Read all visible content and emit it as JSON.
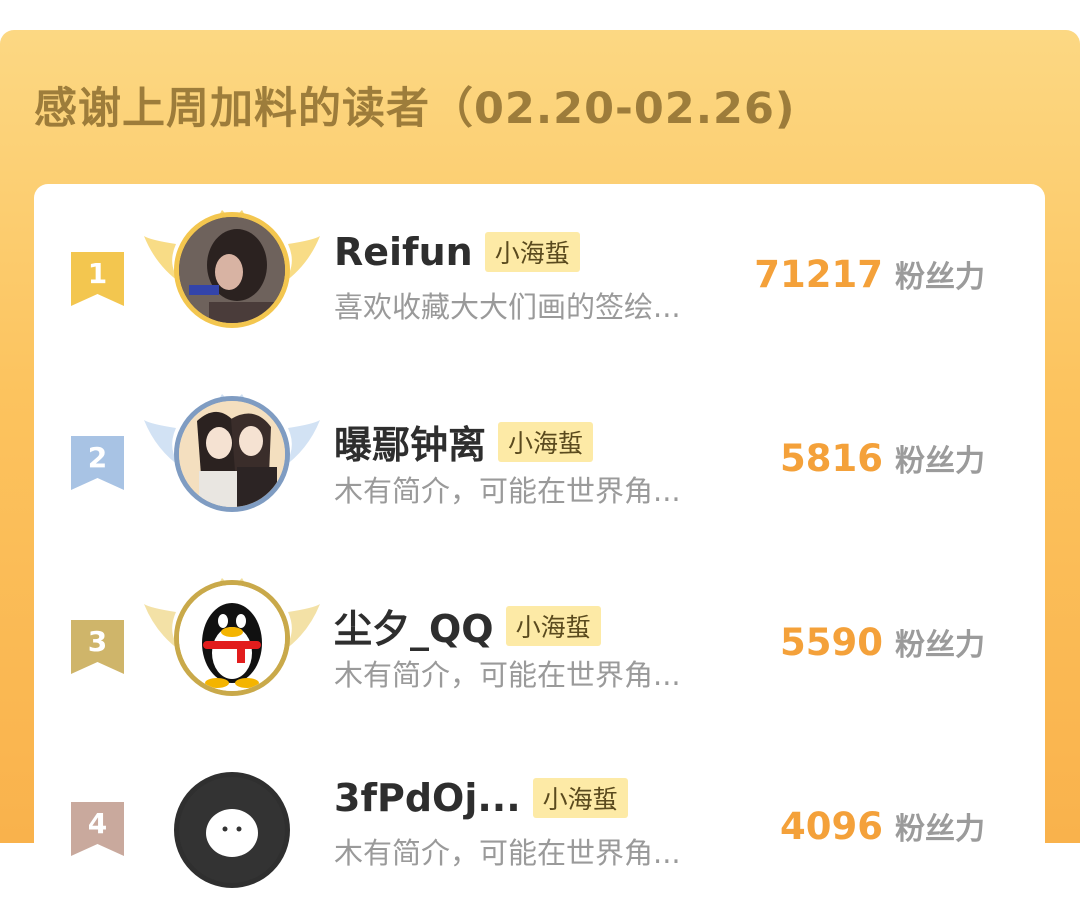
{
  "header": {
    "title": "感谢上周加料的读者（02.20-02.26)"
  },
  "colors": {
    "panel_gradient": [
      "#fcd883",
      "#f9b24c"
    ],
    "score": "#f4a13a",
    "rank_gold": "#f3c64f",
    "rank_silver": "#a8c3e4",
    "rank_bronze": "#cfb56a",
    "rank_other": "#c9a99d"
  },
  "readers": [
    {
      "rank": "1",
      "name": "Reifun",
      "badge": "小海蜇",
      "bio": "喜欢收藏大大们画的签绘...",
      "score": "71217",
      "score_unit": "粉丝力",
      "avatar": "photo-avatar"
    },
    {
      "rank": "2",
      "name": "曝鄢钟离",
      "badge": "小海蜇",
      "bio": "木有简介，可能在世界角...",
      "score": "5816",
      "score_unit": "粉丝力",
      "avatar": "anime-avatar"
    },
    {
      "rank": "3",
      "name": "尘夕_QQ",
      "badge": "小海蜇",
      "bio": "木有简介，可能在世界角...",
      "score": "5590",
      "score_unit": "粉丝力",
      "avatar": "qq-penguin-avatar"
    },
    {
      "rank": "4",
      "name": "3fPdOj...",
      "badge": "小海蜇",
      "bio": "木有简介，可能在世界角...",
      "score": "4096",
      "score_unit": "粉丝力",
      "avatar": "default-avatar"
    }
  ]
}
